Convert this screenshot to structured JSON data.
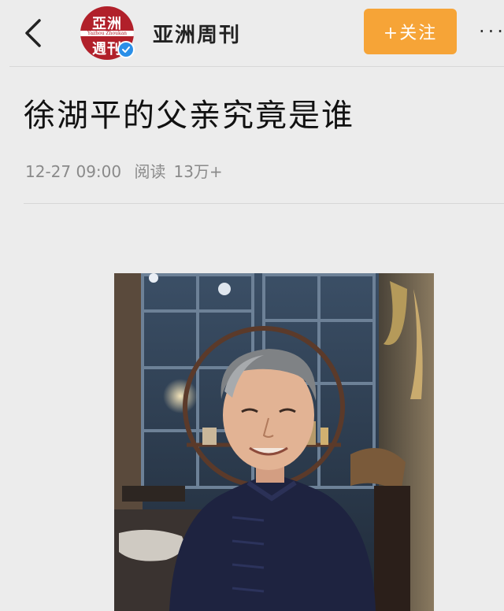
{
  "header": {
    "account_name": "亚洲周刊",
    "avatar_text": {
      "line1": "亞洲",
      "line2": "Yazhou Zhoukan",
      "line3": "週刊"
    },
    "follow_label": "+关注",
    "more_label": "···"
  },
  "article": {
    "title": "徐湖平的父亲究竟是谁",
    "date": "12-27 09:00",
    "read_label": "阅读",
    "read_count": "13万+"
  },
  "colors": {
    "follow_button": "#f6a437",
    "avatar_brand": "#b1202a",
    "verified_badge": "#2a8fe8"
  },
  "icons": {
    "back": "chevron-left-icon",
    "verified": "verified-check-icon",
    "more": "more-dots-icon"
  }
}
